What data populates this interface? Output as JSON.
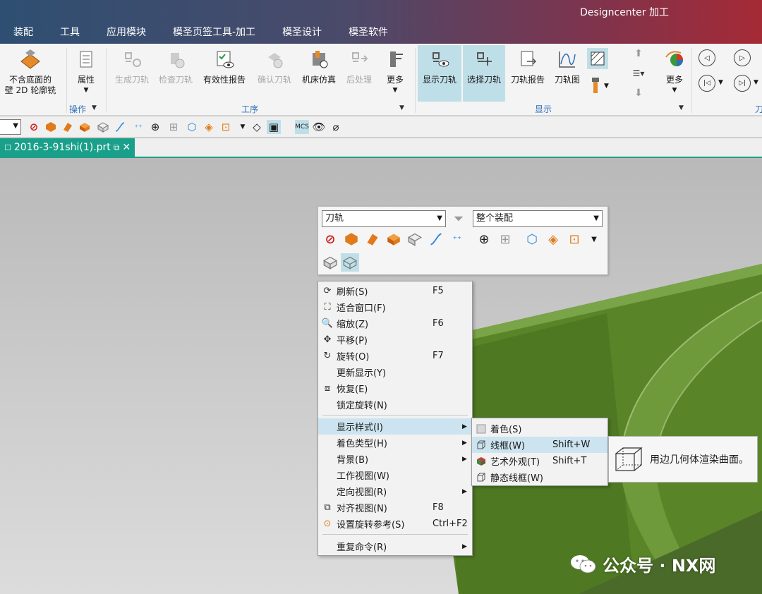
{
  "window": {
    "title": "Designcenter 加工"
  },
  "menubar": [
    "装配",
    "工具",
    "应用模块",
    "模圣页签工具-加工",
    "模圣设计",
    "模圣软件"
  ],
  "ribbon": {
    "first_button": {
      "line1": "不含底面的",
      "line2": "壁 2D 轮廓铣"
    },
    "attributes": "属性",
    "operations_group": "操作",
    "process_buttons": [
      "生成刀轨",
      "检查刀轨",
      "有效性报告",
      "确认刀轨",
      "机床仿真",
      "后处理",
      "更多"
    ],
    "process_group": "工序",
    "display_buttons": [
      "显示刀轨",
      "选择刀轨",
      "刀轨报告",
      "刀轨图"
    ],
    "display_more": "更多",
    "display_group": "显示",
    "partial_group": "刀"
  },
  "tab": {
    "filename": "2016-3-91shi(1).prt"
  },
  "minibar": {
    "filter_value": "刀轨",
    "scope_value": "整个装配"
  },
  "context_menu": {
    "items": [
      {
        "label": "刷新(S)",
        "shortcut": "F5",
        "icon": "refresh-icon"
      },
      {
        "label": "适合窗口(F)",
        "shortcut": "",
        "icon": "fit-window-icon"
      },
      {
        "label": "缩放(Z)",
        "shortcut": "F6",
        "icon": "zoom-icon"
      },
      {
        "label": "平移(P)",
        "shortcut": "",
        "icon": "pan-icon"
      },
      {
        "label": "旋转(O)",
        "shortcut": "F7",
        "icon": "rotate-icon"
      },
      {
        "label": "更新显示(Y)",
        "shortcut": "",
        "icon": ""
      },
      {
        "label": "恢复(E)",
        "shortcut": "",
        "icon": "restore-icon"
      },
      {
        "label": "锁定旋转(N)",
        "shortcut": "",
        "icon": ""
      },
      {
        "label": "显示样式(I)",
        "shortcut": "",
        "icon": ""
      },
      {
        "label": "着色类型(H)",
        "shortcut": "",
        "icon": ""
      },
      {
        "label": "背景(B)",
        "shortcut": "",
        "icon": ""
      },
      {
        "label": "工作视图(W)",
        "shortcut": "",
        "icon": ""
      },
      {
        "label": "定向视图(R)",
        "shortcut": "",
        "icon": ""
      },
      {
        "label": "对齐视图(N)",
        "shortcut": "F8",
        "icon": "align-view-icon"
      },
      {
        "label": "设置旋转参考(S)",
        "shortcut": "Ctrl+F2",
        "icon": "rotate-reference-icon"
      },
      {
        "label": "重复命令(R)",
        "shortcut": "",
        "icon": ""
      }
    ]
  },
  "submenu": {
    "items": [
      {
        "label": "着色(S)",
        "shortcut": ""
      },
      {
        "label": "线框(W)",
        "shortcut": "Shift+W"
      },
      {
        "label": "艺术外观(T)",
        "shortcut": "Shift+T"
      },
      {
        "label": "静态线框(W)",
        "shortcut": ""
      }
    ]
  },
  "tooltip": {
    "text": "用边几何体渲染曲面。"
  },
  "watermark": {
    "text": "公众号 · NX网"
  },
  "colors": {
    "accent_tab": "#1aa08a",
    "highlight": "#cce4ef",
    "model_green": "#5f8a2a"
  }
}
